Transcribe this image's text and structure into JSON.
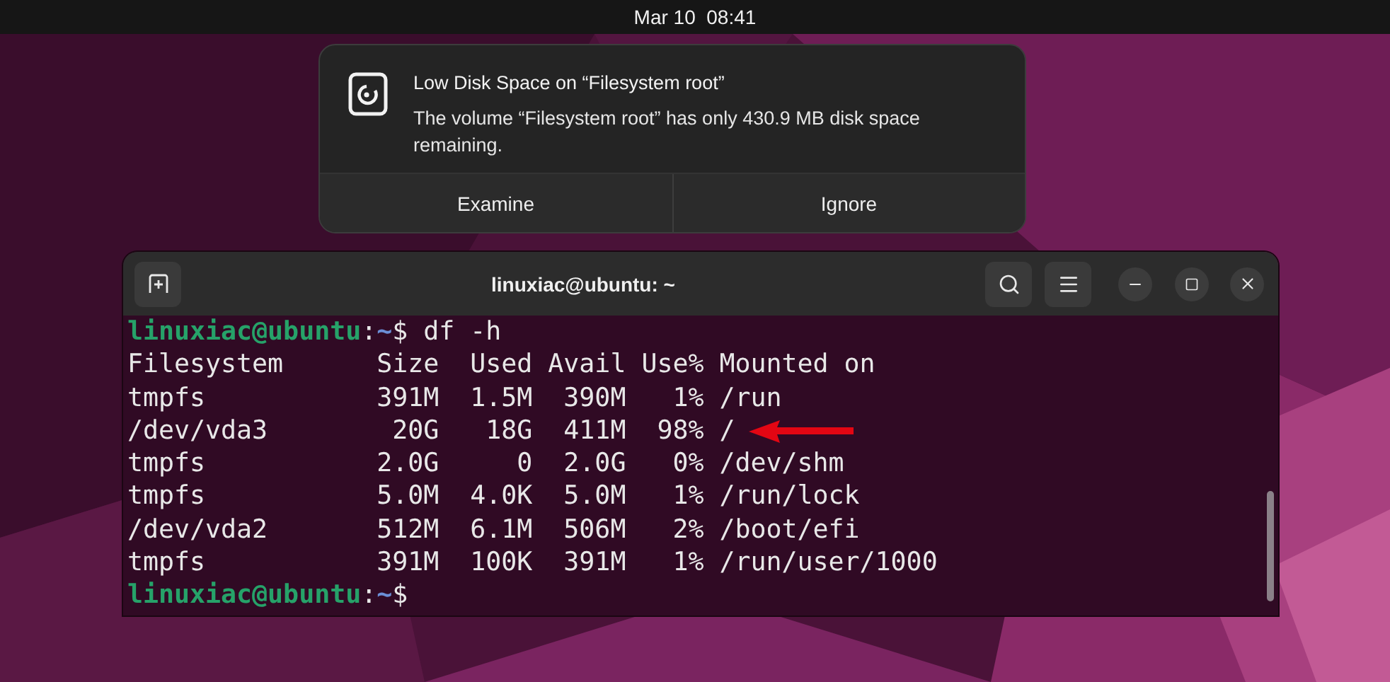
{
  "top_bar": {
    "clock": "Mar 10  08:41"
  },
  "notification": {
    "title": "Low Disk Space on “Filesystem root”",
    "body": "The volume “Filesystem root” has only 430.9 MB disk space remaining.",
    "actions": [
      {
        "label": "Examine"
      },
      {
        "label": "Ignore"
      }
    ]
  },
  "terminal": {
    "title": "linuxiac@ubuntu: ~",
    "lines": [
      {
        "kind": "prompt",
        "user": "linuxiac@ubuntu",
        "separator": ":",
        "path": "~",
        "symbol": "$",
        "command": "df -h"
      },
      {
        "kind": "output",
        "text": "Filesystem      Size  Used Avail Use% Mounted on",
        "marked": false
      },
      {
        "kind": "output",
        "text": "tmpfs           391M  1.5M  390M   1% /run",
        "marked": false
      },
      {
        "kind": "output",
        "text": "/dev/vda3        20G   18G  411M  98% /",
        "marked": true
      },
      {
        "kind": "output",
        "text": "tmpfs           2.0G     0  2.0G   0% /dev/shm",
        "marked": false
      },
      {
        "kind": "output",
        "text": "tmpfs           5.0M  4.0K  5.0M   1% /run/lock",
        "marked": false
      },
      {
        "kind": "output",
        "text": "/dev/vda2       512M  6.1M  506M   2% /boot/efi",
        "marked": false
      },
      {
        "kind": "output",
        "text": "tmpfs           391M  100K  391M   1% /run/user/1000",
        "marked": false
      },
      {
        "kind": "prompt",
        "user": "linuxiac@ubuntu",
        "separator": ":",
        "path": "~",
        "symbol": "$"
      }
    ]
  }
}
